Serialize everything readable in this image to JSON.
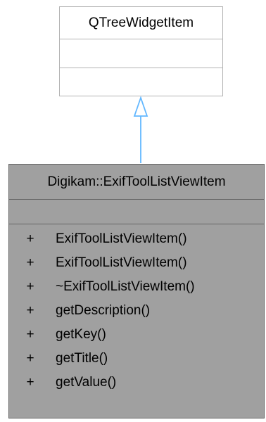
{
  "parent_class": {
    "name": "QTreeWidgetItem"
  },
  "child_class": {
    "name": "Digikam::ExifToolListViewItem",
    "methods": [
      {
        "visibility": "+",
        "name": "ExifToolListViewItem()"
      },
      {
        "visibility": "+",
        "name": "ExifToolListViewItem()"
      },
      {
        "visibility": "+",
        "name": "~ExifToolListViewItem()"
      },
      {
        "visibility": "+",
        "name": "getDescription()"
      },
      {
        "visibility": "+",
        "name": "getKey()"
      },
      {
        "visibility": "+",
        "name": "getTitle()"
      },
      {
        "visibility": "+",
        "name": "getValue()"
      }
    ]
  },
  "colors": {
    "inheritance_arrow": "#63b8ff",
    "child_fill": "#a0a0a0",
    "child_border": "#666666",
    "parent_border": "#b3b3b3"
  }
}
